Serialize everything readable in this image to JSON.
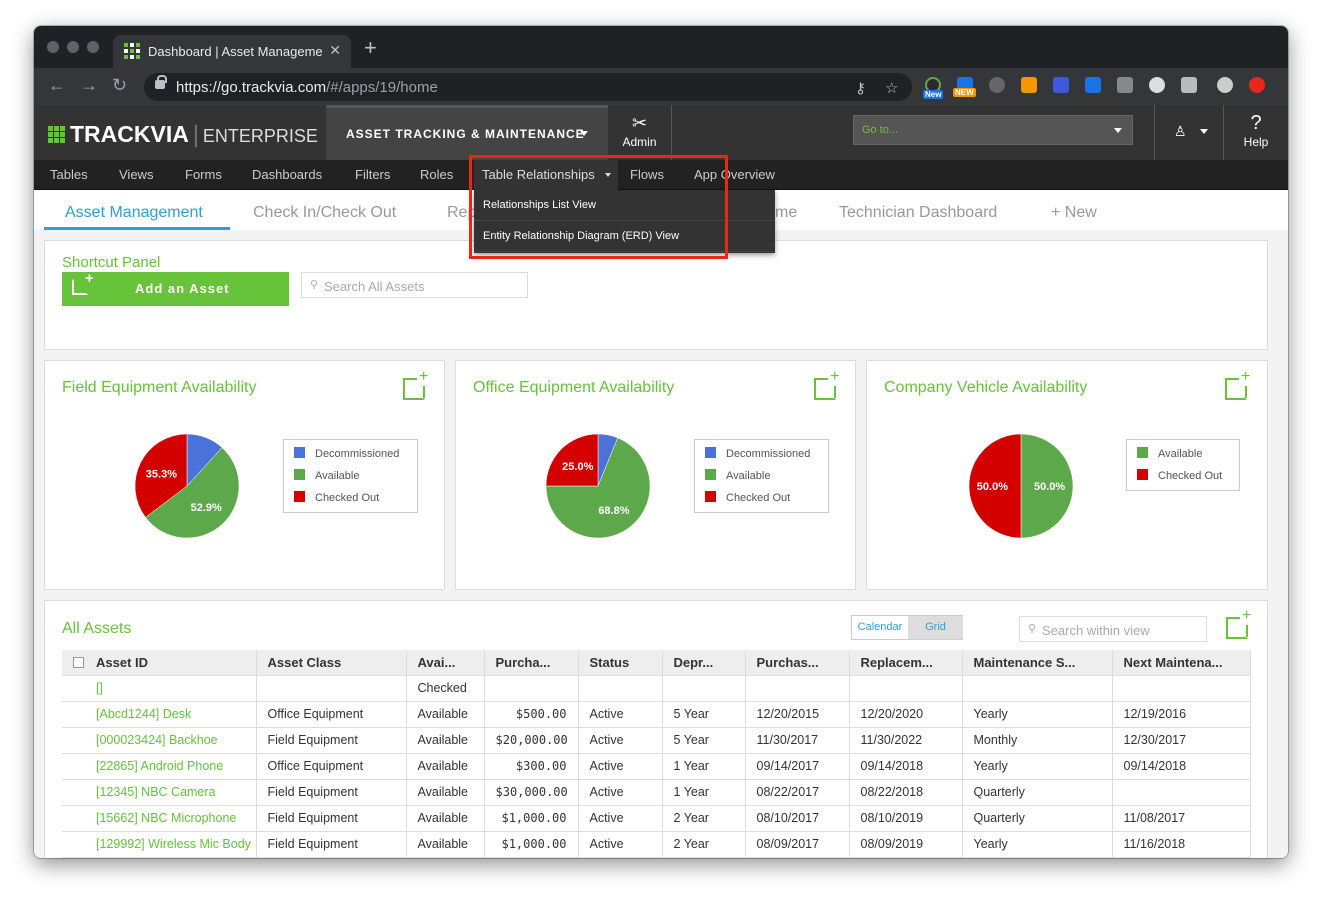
{
  "browser": {
    "tab_title": "Dashboard | Asset Management",
    "url_host": "https://go.trackvia.com",
    "url_path": "/#/apps/19/home",
    "ext_badge_new1": "New",
    "ext_badge_new2": "NEW"
  },
  "app_header": {
    "logo_brand": "TRACKVIA",
    "logo_edition": "ENTERPRISE",
    "app_selector": "ASSET TRACKING & MAINTENANCE",
    "admin_label": "Admin",
    "goto_placeholder": "Go to...",
    "help_label": "Help"
  },
  "menu": {
    "items": [
      "Tables",
      "Views",
      "Forms",
      "Dashboards",
      "Filters",
      "Roles",
      "Table Relationships",
      "Flows",
      "App Overview"
    ],
    "dropdown": [
      "Relationships List View",
      "Entity Relationship Diagram (ERD) View"
    ]
  },
  "dashboard_tabs": [
    "Asset Management",
    "Check In/Check Out",
    "Rep",
    "me",
    "Technician Dashboard",
    "+ New"
  ],
  "shortcut": {
    "title": "Shortcut Panel",
    "add_label": "Add an Asset",
    "search_placeholder": "Search All Assets"
  },
  "charts": {
    "colors": {
      "Decommissioned": "#4a72d8",
      "Available": "#5ea84c",
      "Checked Out": "#d40000"
    },
    "chart_data": [
      {
        "type": "pie",
        "title": "Field Equipment Availability",
        "labels": [
          "Decommissioned",
          "Available",
          "Checked Out"
        ],
        "values": [
          11.8,
          52.9,
          35.3
        ],
        "data_labels": [
          "",
          "52.9%",
          "35.3%"
        ]
      },
      {
        "type": "pie",
        "title": "Office Equipment Availability",
        "labels": [
          "Decommissioned",
          "Available",
          "Checked Out"
        ],
        "values": [
          6.2,
          68.8,
          25.0
        ],
        "data_labels": [
          "",
          "68.8%",
          "25.0%"
        ]
      },
      {
        "type": "pie",
        "title": "Company Vehicle Availability",
        "labels": [
          "Available",
          "Checked Out"
        ],
        "values": [
          50.0,
          50.0
        ],
        "data_labels": [
          "50.0%",
          "50.0%"
        ]
      }
    ]
  },
  "all_assets": {
    "title": "All Assets",
    "calendar_label": "Calendar",
    "grid_label": "Grid",
    "search_placeholder": "Search within view",
    "columns": [
      "Asset ID",
      "Asset Class",
      "Avai...",
      "Purcha...",
      "Status",
      "Depr...",
      "Purchas...",
      "Replacem...",
      "Maintenance S...",
      "Next Maintena..."
    ],
    "rows": [
      [
        "[]",
        "",
        "Checked",
        "",
        "",
        "",
        "",
        "",
        "",
        ""
      ],
      [
        "[Abcd1244] Desk",
        "Office Equipment",
        "Available",
        "$500.00",
        "Active",
        "5 Year",
        "12/20/2015",
        "12/20/2020",
        "Yearly",
        "12/19/2016"
      ],
      [
        "[000023424] Backhoe",
        "Field Equipment",
        "Available",
        "$20,000.00",
        "Active",
        "5 Year",
        "11/30/2017",
        "11/30/2022",
        "Monthly",
        "12/30/2017"
      ],
      [
        "[22865] Android Phone",
        "Office Equipment",
        "Available",
        "$300.00",
        "Active",
        "1 Year",
        "09/14/2017",
        "09/14/2018",
        "Yearly",
        "09/14/2018"
      ],
      [
        "[12345] NBC Camera",
        "Field Equipment",
        "Available",
        "$30,000.00",
        "Active",
        "1 Year",
        "08/22/2017",
        "08/22/2018",
        "Quarterly",
        ""
      ],
      [
        "[15662] NBC Microphone",
        "Field Equipment",
        "Available",
        "$1,000.00",
        "Active",
        "2 Year",
        "08/10/2017",
        "08/10/2019",
        "Quarterly",
        "11/08/2017"
      ],
      [
        "[129992] Wireless Mic Body",
        "Field Equipment",
        "Available",
        "$1,000.00",
        "Active",
        "2 Year",
        "08/09/2017",
        "08/09/2019",
        "Yearly",
        "11/16/2018"
      ]
    ]
  }
}
